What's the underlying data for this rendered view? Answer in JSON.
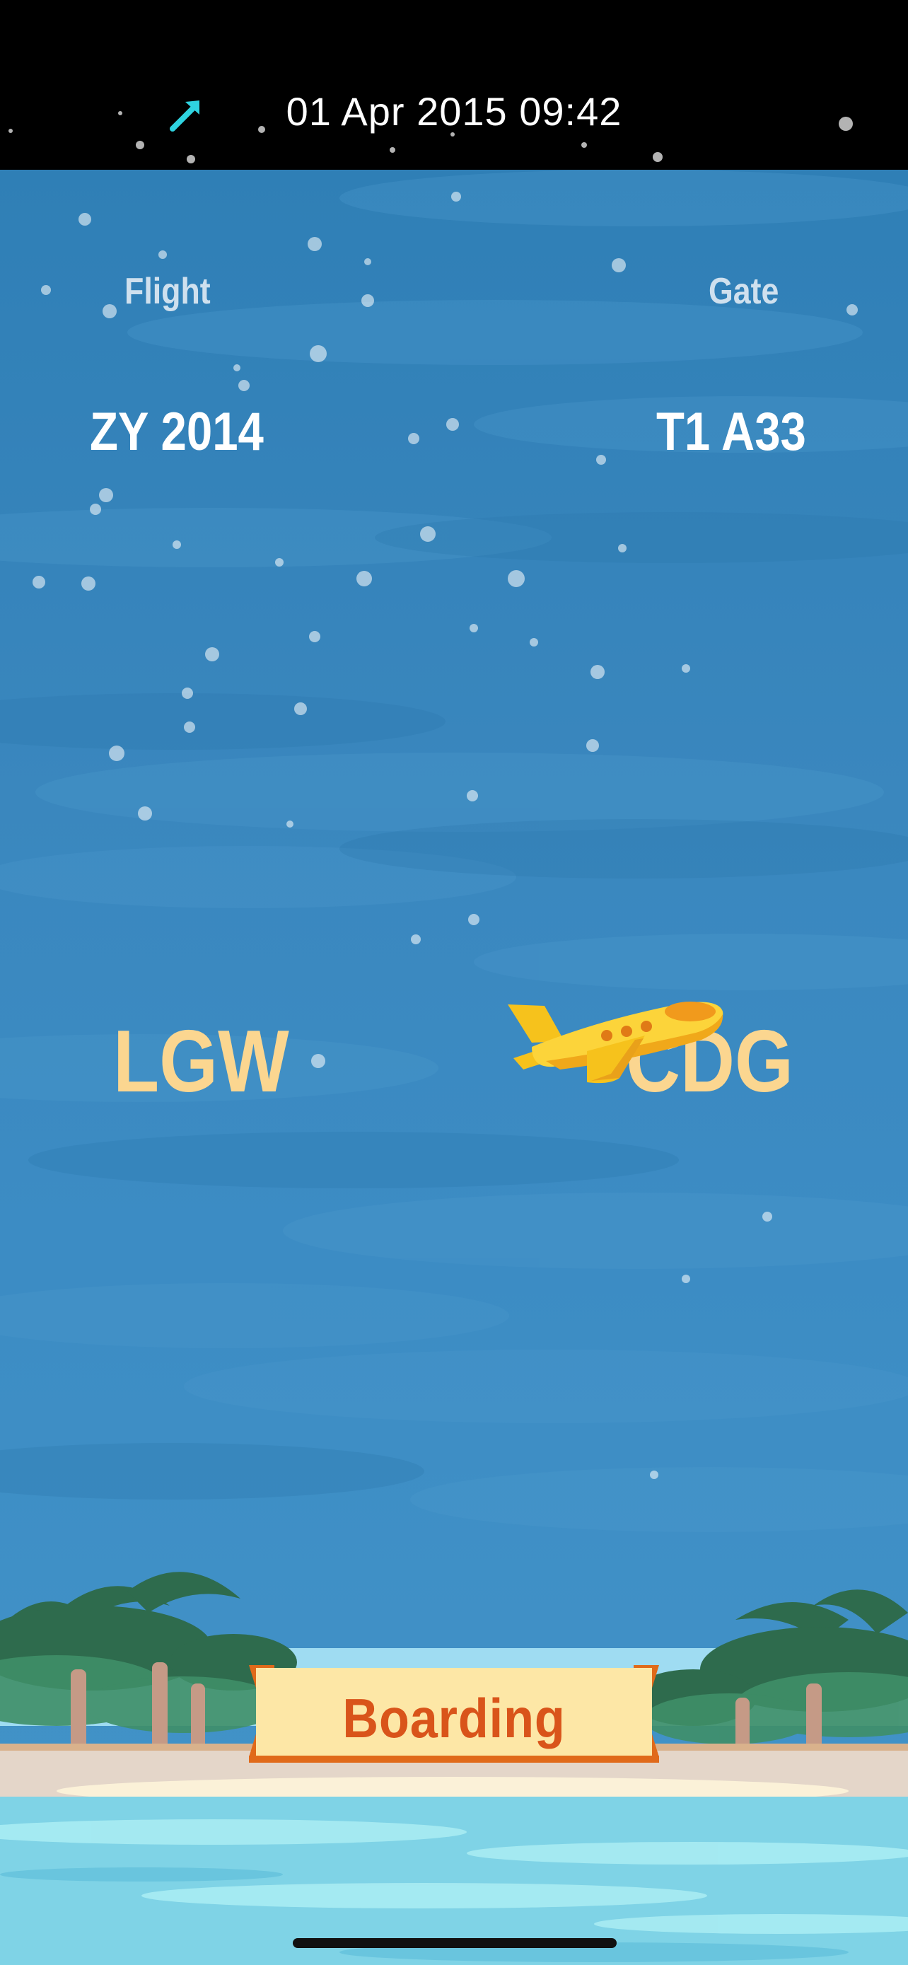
{
  "status_bar": {
    "datetime": "01 Apr 2015 09:42",
    "location_icon": "location-arrow-icon"
  },
  "flight": {
    "label": "Flight",
    "value": "ZY 2014"
  },
  "gate": {
    "label": "Gate",
    "value": "T1 A33"
  },
  "route": {
    "origin": "LGW",
    "destination": "CDG",
    "plane_icon": "airplane-icon"
  },
  "status": {
    "label": "Boarding"
  },
  "colors": {
    "sky": "#3a87be",
    "airport_code": "#fbd690",
    "banner_fill": "#fde7a6",
    "banner_text": "#d9541a",
    "status_arrow": "#2fd3e0"
  }
}
